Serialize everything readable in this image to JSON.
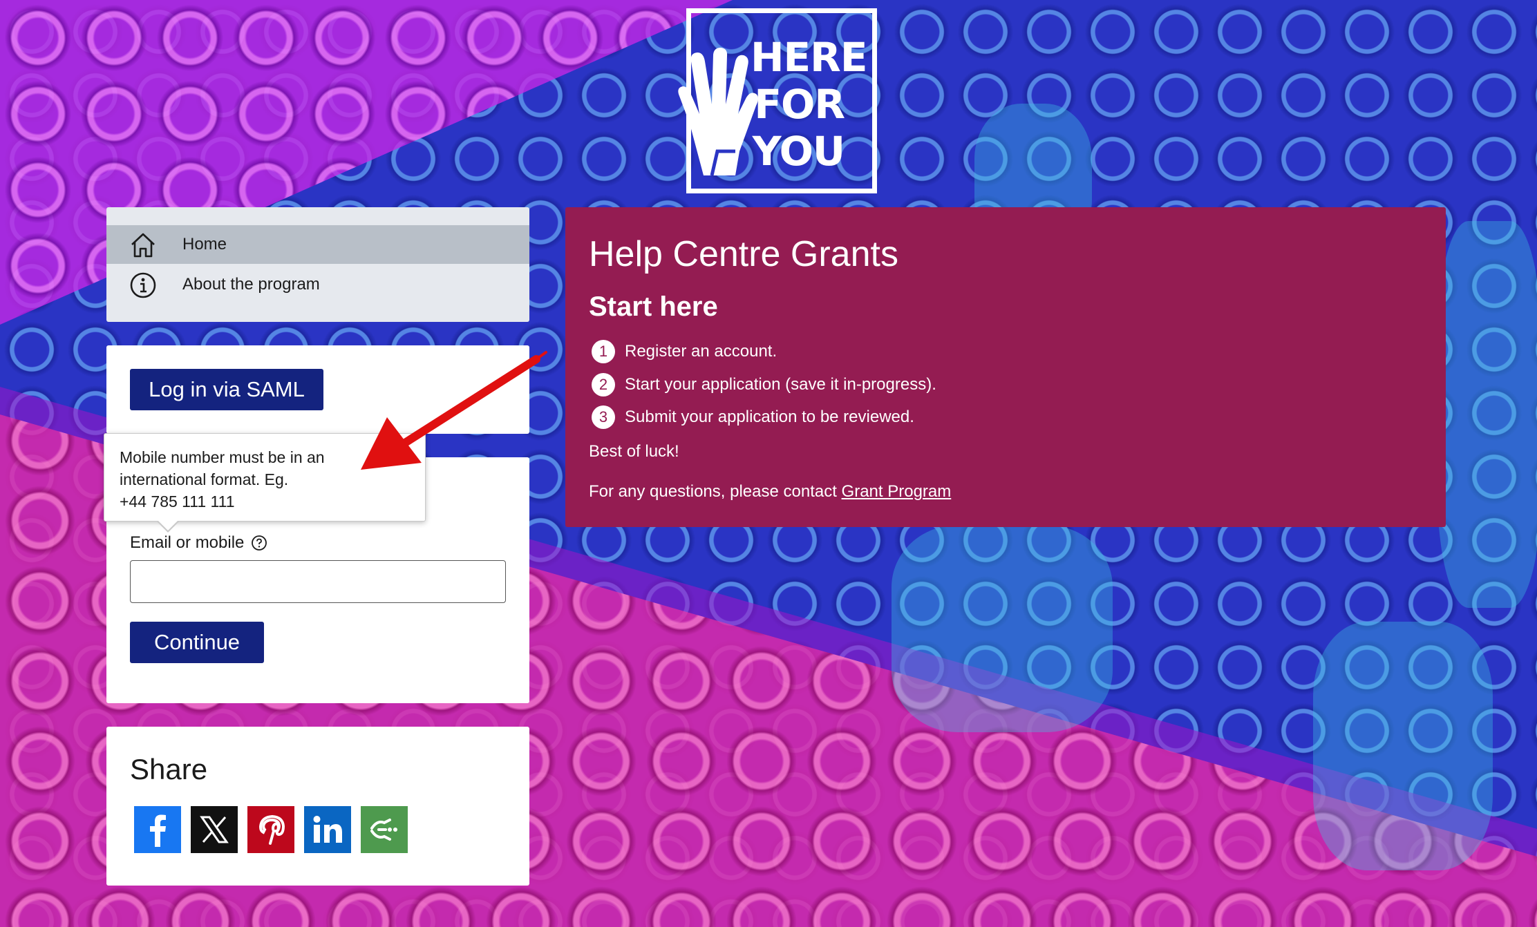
{
  "logo": {
    "lines": [
      "HERE",
      "FOR",
      "YOU"
    ]
  },
  "nav": {
    "items": [
      {
        "label": "Home",
        "icon": "home-icon",
        "active": true
      },
      {
        "label": "About the program",
        "icon": "info-icon",
        "active": false
      }
    ]
  },
  "saml": {
    "button_label": "Log in via SAML"
  },
  "login": {
    "field_label": "Email or mobile",
    "help_icon": "question-circle-icon",
    "input_value": "",
    "continue_label": "Continue"
  },
  "tooltip": {
    "lines": [
      "Mobile number must be in an",
      "international format. Eg.",
      "+44 785 111 111"
    ]
  },
  "share": {
    "title": "Share",
    "buttons": [
      {
        "name": "facebook",
        "color": "#1877f2"
      },
      {
        "name": "x",
        "color": "#111111"
      },
      {
        "name": "pinterest",
        "color": "#bd081c"
      },
      {
        "name": "linkedin",
        "color": "#0a66c2"
      },
      {
        "name": "more",
        "color": "#4e9a4e"
      }
    ]
  },
  "main": {
    "title": "Help Centre Grants",
    "subtitle": "Start here",
    "steps": [
      {
        "num": "1",
        "text": "Register an account."
      },
      {
        "num": "2",
        "text": "Start your application (save it in-progress)."
      },
      {
        "num": "3",
        "text": "Submit your application to be reviewed."
      }
    ],
    "best_luck": "Best of luck!",
    "contact_prefix": "For any questions, please contact ",
    "contact_link": "Grant Program"
  },
  "colors": {
    "card": "#941c52",
    "button": "#14237f",
    "annotation_arrow": "#e01010"
  }
}
